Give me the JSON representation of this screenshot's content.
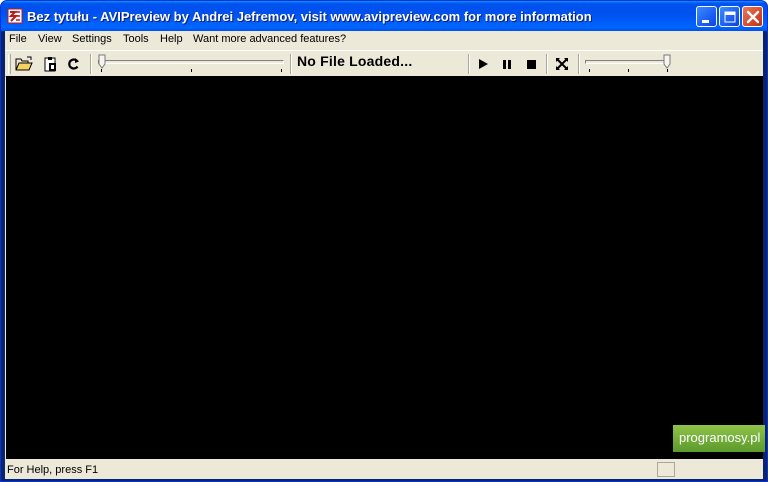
{
  "window": {
    "title": "Bez tytułu - AVIPreview  by Andrei Jefremov, visit www.avipreview.com for more information",
    "icon": "avipreview-app-icon"
  },
  "title_buttons": {
    "minimize": "minimize-icon",
    "maximize": "maximize-icon",
    "close": "close-icon"
  },
  "menu": {
    "items": [
      "File",
      "View",
      "Settings",
      "Tools",
      "Help",
      "Want more advanced features?"
    ]
  },
  "toolbar": {
    "open_icon": "open-folder-icon",
    "clipboard_icon": "clipboard-icon",
    "refresh_icon": "refresh-icon",
    "file_status": "No File Loaded...",
    "play_icon": "play-icon",
    "pause_icon": "pause-icon",
    "stop_icon": "stop-icon",
    "fullscreen_icon": "fullscreen-icon",
    "position": 0,
    "volume": 1
  },
  "status": {
    "help_text": "For Help, press F1"
  },
  "watermark": {
    "text": "programosy.pl"
  },
  "colors": {
    "titlebar": "#0055ea",
    "video_background": "#000000",
    "chrome": "#ece9d8",
    "close_button": "#d9492b",
    "watermark": "#6fad36"
  }
}
